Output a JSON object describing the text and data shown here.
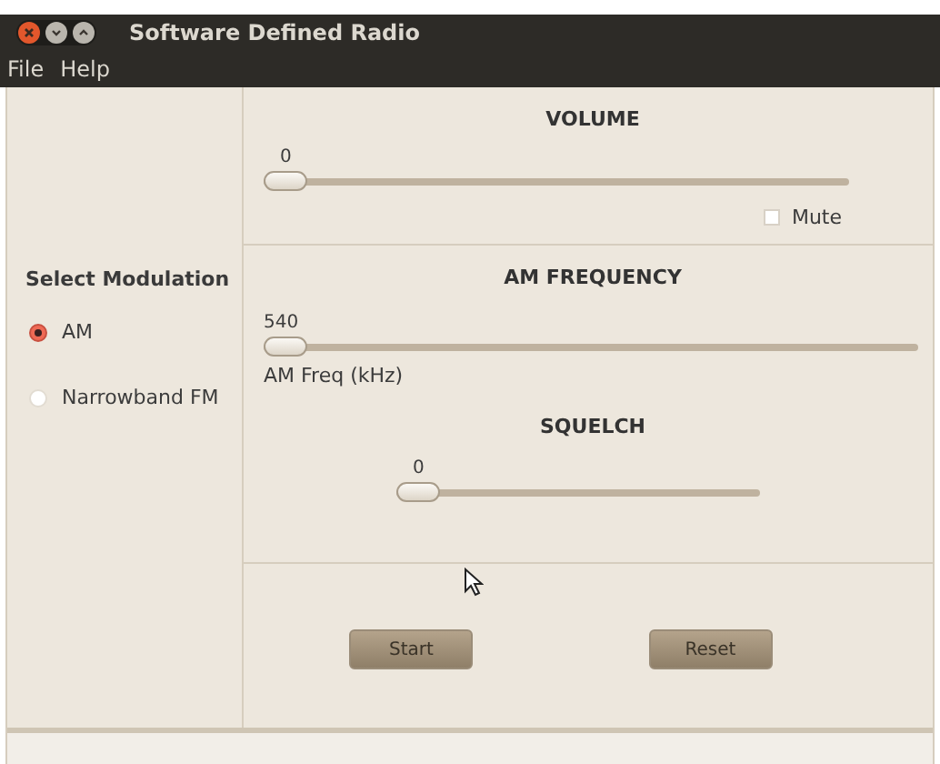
{
  "window": {
    "title": "Software Defined Radio"
  },
  "menu": [
    "File",
    "Help"
  ],
  "modulation": {
    "title": "Select Modulation",
    "options": [
      {
        "label": "AM",
        "selected": true
      },
      {
        "label": "Narrowband FM",
        "selected": false
      }
    ]
  },
  "volume": {
    "title": "VOLUME",
    "reading": "0",
    "level": 0,
    "mute": {
      "label": "Mute",
      "checked": false
    }
  },
  "frequency": {
    "title": "AM FREQUENCY",
    "reading": "540",
    "level": 0,
    "caption": "AM Freq (kHz)"
  },
  "squelch": {
    "title": "SQUELCH",
    "reading": "0",
    "level": 0
  },
  "buttons": [
    "Start",
    "Reset"
  ]
}
